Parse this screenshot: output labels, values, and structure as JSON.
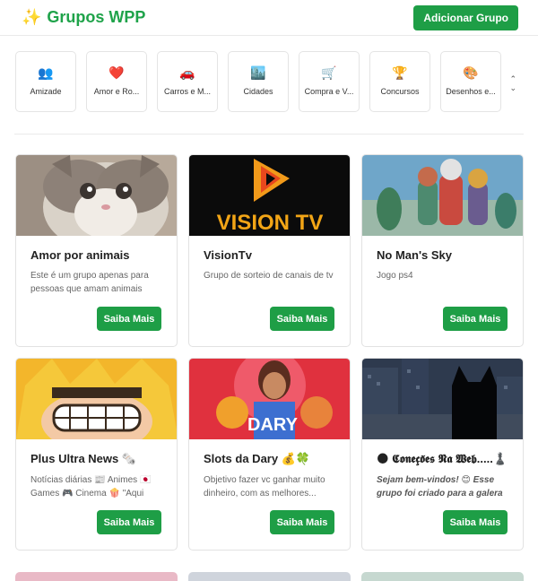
{
  "header": {
    "logo_icon": "sparkles-icon",
    "title": "Grupos WPP",
    "add_button": "Adicionar Grupo",
    "brand_color": "#1e9e46"
  },
  "categories": [
    {
      "icon": "people-icon",
      "glyph": "👥",
      "label": "Amizade"
    },
    {
      "icon": "heart-icon",
      "glyph": "❤️",
      "label": "Amor e Ro..."
    },
    {
      "icon": "car-icon",
      "glyph": "🚗",
      "label": "Carros e M..."
    },
    {
      "icon": "city-icon",
      "glyph": "🏙️",
      "label": "Cidades"
    },
    {
      "icon": "cart-icon",
      "glyph": "🛒",
      "label": "Compra e V..."
    },
    {
      "icon": "trophy-icon",
      "glyph": "🏆",
      "label": "Concursos"
    },
    {
      "icon": "palette-icon",
      "glyph": "🎨",
      "label": "Desenhos e..."
    }
  ],
  "scroll_icon": "chevron-up-down-icon",
  "groups": [
    {
      "name": "Amor por animais",
      "description": "Este é um grupo apenas para pessoas que amam animais",
      "button": "Saiba Mais",
      "image": "kitten-photo"
    },
    {
      "name": "VisionTv",
      "description": "Grupo de sorteio de canais de tv",
      "button": "Saiba Mais",
      "image": "vision-tv-logo",
      "image_text": "VISION TV"
    },
    {
      "name": "No Man's Sky",
      "description": "Jogo ps4",
      "button": "Saiba Mais",
      "image": "game-characters"
    },
    {
      "name": "Plus Ultra News 🗞️",
      "description": "Notícias diárias 📰 Animes 🇯🇵 Games 🎮 Cinema 🍿 \"Aqui no...",
      "button": "Saiba Mais",
      "image": "anime-grin"
    },
    {
      "name": "Slots da Dary 💰🍀",
      "description": "Objetivo fazer vc ganhar muito dinheiro, com as melhores...",
      "button": "Saiba Mais",
      "image": "slots-banner",
      "image_text": "DARY"
    },
    {
      "name": "🌑 𝕮𝖔𝖓𝖊𝖈̧𝖔̃𝖊𝖘 𝕹𝖆 𝖂𝖊𝖇.....♟️",
      "description": "Sejam bem-vindos! 😊 Esse grupo foi criado para a galera se divert...",
      "button": "Saiba Mais",
      "image": "night-city-cat"
    }
  ]
}
